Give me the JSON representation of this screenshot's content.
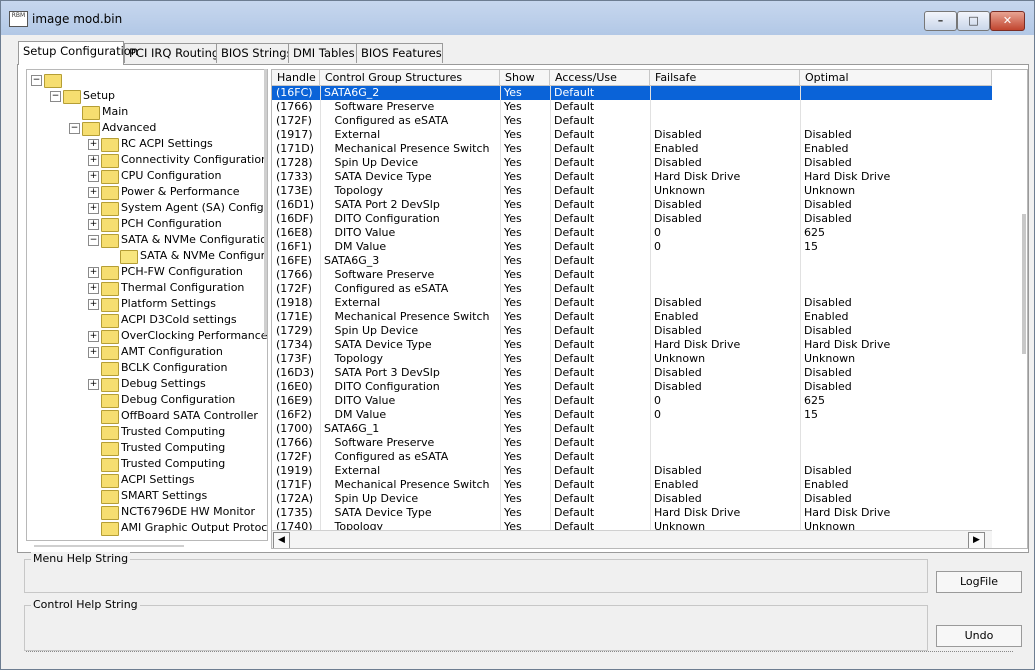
{
  "window": {
    "title": "image mod.bin",
    "icon_label": "RBM"
  },
  "tabs": [
    "Setup Configuration",
    "PCI IRQ Routing",
    "BIOS Strings",
    "DMI Tables",
    "BIOS Features"
  ],
  "tree": [
    {
      "label": "",
      "level": 0,
      "expander": "minus"
    },
    {
      "label": "Setup",
      "level": 1,
      "expander": "minus"
    },
    {
      "label": "Main",
      "level": 2,
      "expander": ""
    },
    {
      "label": "Advanced",
      "level": 2,
      "expander": "minus"
    },
    {
      "label": "RC ACPI Settings",
      "level": 3,
      "expander": "plus"
    },
    {
      "label": "Connectivity Configuration",
      "level": 3,
      "expander": "plus"
    },
    {
      "label": "CPU Configuration",
      "level": 3,
      "expander": "plus"
    },
    {
      "label": "Power & Performance",
      "level": 3,
      "expander": "plus"
    },
    {
      "label": "System Agent (SA) Configuration",
      "level": 3,
      "expander": "plus"
    },
    {
      "label": "PCH Configuration",
      "level": 3,
      "expander": "plus"
    },
    {
      "label": "SATA & NVMe Configuration",
      "level": 3,
      "expander": "minus"
    },
    {
      "label": "SATA & NVMe Configuration",
      "level": 4,
      "expander": "",
      "open": true
    },
    {
      "label": "PCH-FW Configuration",
      "level": 3,
      "expander": "plus"
    },
    {
      "label": "Thermal Configuration",
      "level": 3,
      "expander": "plus"
    },
    {
      "label": "Platform Settings",
      "level": 3,
      "expander": "plus"
    },
    {
      "label": "ACPI D3Cold settings",
      "level": 3,
      "expander": ""
    },
    {
      "label": "OverClocking Performance",
      "level": 3,
      "expander": "plus"
    },
    {
      "label": "AMT Configuration",
      "level": 3,
      "expander": "plus"
    },
    {
      "label": "BCLK Configuration",
      "level": 3,
      "expander": ""
    },
    {
      "label": "Debug Settings",
      "level": 3,
      "expander": "plus"
    },
    {
      "label": "Debug Configuration",
      "level": 3,
      "expander": ""
    },
    {
      "label": "OffBoard SATA Controller",
      "level": 3,
      "expander": ""
    },
    {
      "label": "Trusted Computing",
      "level": 3,
      "expander": ""
    },
    {
      "label": "Trusted Computing",
      "level": 3,
      "expander": ""
    },
    {
      "label": "Trusted Computing",
      "level": 3,
      "expander": ""
    },
    {
      "label": "ACPI Settings",
      "level": 3,
      "expander": ""
    },
    {
      "label": "SMART Settings",
      "level": 3,
      "expander": ""
    },
    {
      "label": "NCT6796DE HW Monitor",
      "level": 3,
      "expander": ""
    },
    {
      "label": "AMI Graphic Output Protocol",
      "level": 3,
      "expander": ""
    }
  ],
  "grid": {
    "columns": [
      "Handle",
      "Control Group Structures",
      "Show",
      "Access/Use",
      "Failsafe",
      "Optimal"
    ],
    "rows": [
      [
        "(16FC)",
        "SATA6G_2",
        "Yes",
        "Default",
        "",
        ""
      ],
      [
        "(1766)",
        "   Software Preserve",
        "Yes",
        "Default",
        "",
        ""
      ],
      [
        "(172F)",
        "   Configured as eSATA",
        "Yes",
        "Default",
        "",
        ""
      ],
      [
        "(1917)",
        "   External",
        "Yes",
        "Default",
        "Disabled",
        "Disabled"
      ],
      [
        "(171D)",
        "   Mechanical Presence Switch",
        "Yes",
        "Default",
        "Enabled",
        "Enabled"
      ],
      [
        "(1728)",
        "   Spin Up Device",
        "Yes",
        "Default",
        "Disabled",
        "Disabled"
      ],
      [
        "(1733)",
        "   SATA Device Type",
        "Yes",
        "Default",
        "Hard Disk Drive",
        "Hard Disk Drive"
      ],
      [
        "(173E)",
        "   Topology",
        "Yes",
        "Default",
        "Unknown",
        "Unknown"
      ],
      [
        "(16D1)",
        "   SATA Port 2 DevSlp",
        "Yes",
        "Default",
        "Disabled",
        "Disabled"
      ],
      [
        "(16DF)",
        "   DITO Configuration",
        "Yes",
        "Default",
        "Disabled",
        "Disabled"
      ],
      [
        "(16E8)",
        "   DITO Value",
        "Yes",
        "Default",
        "0",
        "625"
      ],
      [
        "(16F1)",
        "   DM Value",
        "Yes",
        "Default",
        "0",
        "15"
      ],
      [
        "(16FE)",
        "SATA6G_3",
        "Yes",
        "Default",
        "",
        ""
      ],
      [
        "(1766)",
        "   Software Preserve",
        "Yes",
        "Default",
        "",
        ""
      ],
      [
        "(172F)",
        "   Configured as eSATA",
        "Yes",
        "Default",
        "",
        ""
      ],
      [
        "(1918)",
        "   External",
        "Yes",
        "Default",
        "Disabled",
        "Disabled"
      ],
      [
        "(171E)",
        "   Mechanical Presence Switch",
        "Yes",
        "Default",
        "Enabled",
        "Enabled"
      ],
      [
        "(1729)",
        "   Spin Up Device",
        "Yes",
        "Default",
        "Disabled",
        "Disabled"
      ],
      [
        "(1734)",
        "   SATA Device Type",
        "Yes",
        "Default",
        "Hard Disk Drive",
        "Hard Disk Drive"
      ],
      [
        "(173F)",
        "   Topology",
        "Yes",
        "Default",
        "Unknown",
        "Unknown"
      ],
      [
        "(16D3)",
        "   SATA Port 3 DevSlp",
        "Yes",
        "Default",
        "Disabled",
        "Disabled"
      ],
      [
        "(16E0)",
        "   DITO Configuration",
        "Yes",
        "Default",
        "Disabled",
        "Disabled"
      ],
      [
        "(16E9)",
        "   DITO Value",
        "Yes",
        "Default",
        "0",
        "625"
      ],
      [
        "(16F2)",
        "   DM Value",
        "Yes",
        "Default",
        "0",
        "15"
      ],
      [
        "(1700)",
        "SATA6G_1",
        "Yes",
        "Default",
        "",
        ""
      ],
      [
        "(1766)",
        "   Software Preserve",
        "Yes",
        "Default",
        "",
        ""
      ],
      [
        "(172F)",
        "   Configured as eSATA",
        "Yes",
        "Default",
        "",
        ""
      ],
      [
        "(1919)",
        "   External",
        "Yes",
        "Default",
        "Disabled",
        "Disabled"
      ],
      [
        "(171F)",
        "   Mechanical Presence Switch",
        "Yes",
        "Default",
        "Enabled",
        "Enabled"
      ],
      [
        "(172A)",
        "   Spin Up Device",
        "Yes",
        "Default",
        "Disabled",
        "Disabled"
      ],
      [
        "(1735)",
        "   SATA Device Type",
        "Yes",
        "Default",
        "Hard Disk Drive",
        "Hard Disk Drive"
      ],
      [
        "(1740)",
        "   Topology",
        "Yes",
        "Default",
        "Unknown",
        "Unknown"
      ]
    ],
    "selected_row": 0
  },
  "help": {
    "menu_label": "Menu Help String",
    "control_label": "Control Help String"
  },
  "buttons": {
    "logfile": "LogFile",
    "undo": "Undo"
  },
  "colors": {
    "selection": "#0a63d8",
    "folder": "#f6de70"
  }
}
